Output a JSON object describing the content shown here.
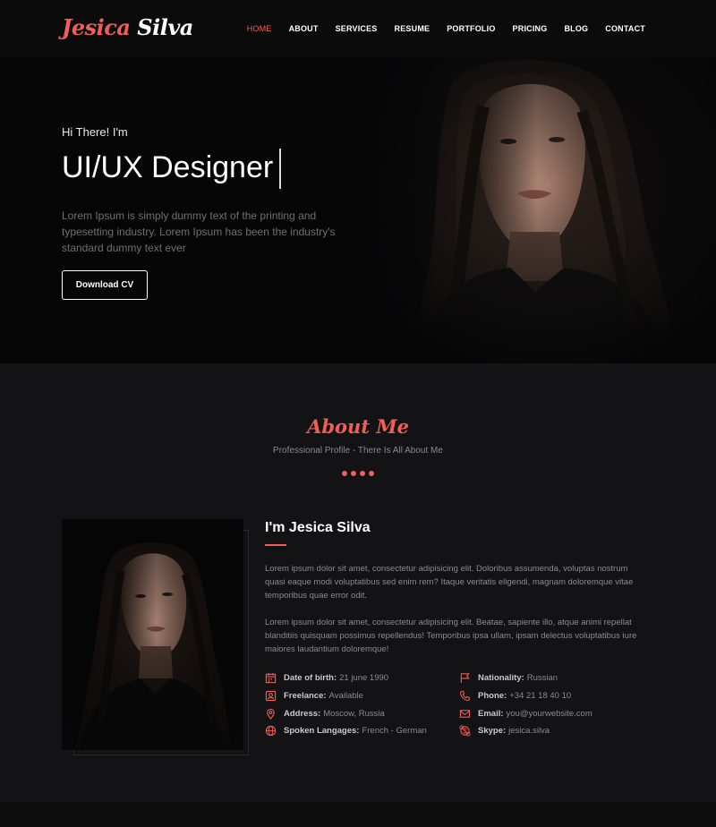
{
  "brand": {
    "first": "Jesica",
    "last": "Silva"
  },
  "nav": {
    "items": [
      "HOME",
      "ABOUT",
      "SERVICES",
      "RESUME",
      "PORTFOLIO",
      "PRICING",
      "BLOG",
      "CONTACT"
    ],
    "active": "HOME"
  },
  "hero": {
    "greeting": "Hi There! I'm",
    "role": "UI/UX Designer",
    "description": "Lorem Ipsum is simply dummy text of the printing and typesetting industry. Lorem Ipsum has been the industry's standard dummy text ever",
    "cta": "Download CV"
  },
  "about": {
    "title": "About Me",
    "subtitle": "Professional Profile - There Is All About Me",
    "name": "I'm Jesica Silva",
    "paragraph1": "Lorem ipsum dolor sit amet, consectetur adipisicing elit. Doloribus assumenda, voluptas nostrum quasi eaque modi voluptatibus sed enim rem? Itaque veritatis eligendi, magnam doloremque vitae temporibus quae error odit.",
    "paragraph2": "Lorem ipsum dolor sit amet, consectetur adipisicing elit. Beatae, sapiente illo, atque animi repellat blanditiis quisquam possimus repellendus! Temporibus ipsa ullam, ipsam delectus voluptatibus iure maiores laudantium doloremque!",
    "details_left": [
      {
        "icon": "calendar-icon",
        "label": "Date of birth:",
        "value": "21 june 1990"
      },
      {
        "icon": "id-card-icon",
        "label": "Freelance:",
        "value": "Available"
      },
      {
        "icon": "map-pin-icon",
        "label": "Address:",
        "value": "Moscow, Russia"
      },
      {
        "icon": "globe-icon",
        "label": "Spoken Langages:",
        "value": "French - German"
      }
    ],
    "details_right": [
      {
        "icon": "flag-icon",
        "label": "Nationality:",
        "value": "Russian"
      },
      {
        "icon": "phone-icon",
        "label": "Phone:",
        "value": "+34 21 18 40 10"
      },
      {
        "icon": "mail-icon",
        "label": "Email:",
        "value": "you@yourwebsite.com"
      },
      {
        "icon": "skype-icon",
        "label": "Skype:",
        "value": "jesica.silva"
      }
    ]
  },
  "colors": {
    "accent": "#ef5e57",
    "background": "#111113",
    "hero_bg": "#060607"
  }
}
